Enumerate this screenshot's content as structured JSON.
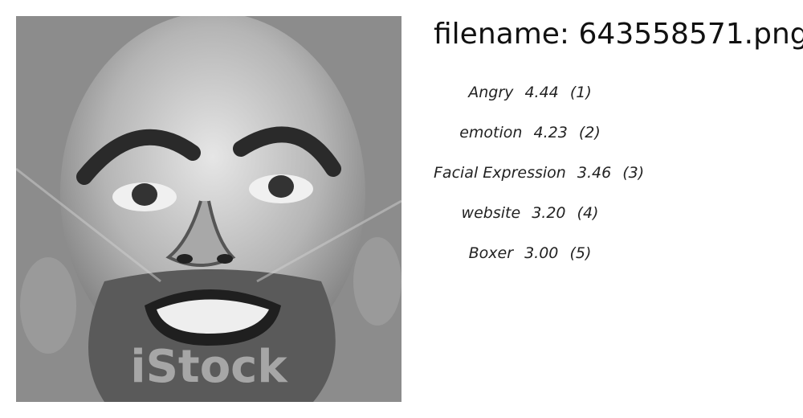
{
  "image": {
    "description_icon": "face-photo-icon"
  },
  "filename_prefix": "filename:",
  "filename": "643558571.png",
  "labels": [
    {
      "name": "Angry",
      "score": "4.44",
      "rank": "(1)"
    },
    {
      "name": "emotion",
      "score": "4.23",
      "rank": "(2)"
    },
    {
      "name": "Facial Expression",
      "score": "3.46",
      "rank": "(3)"
    },
    {
      "name": "website",
      "score": "3.20",
      "rank": "(4)"
    },
    {
      "name": "Boxer",
      "score": "3.00",
      "rank": "(5)"
    }
  ]
}
